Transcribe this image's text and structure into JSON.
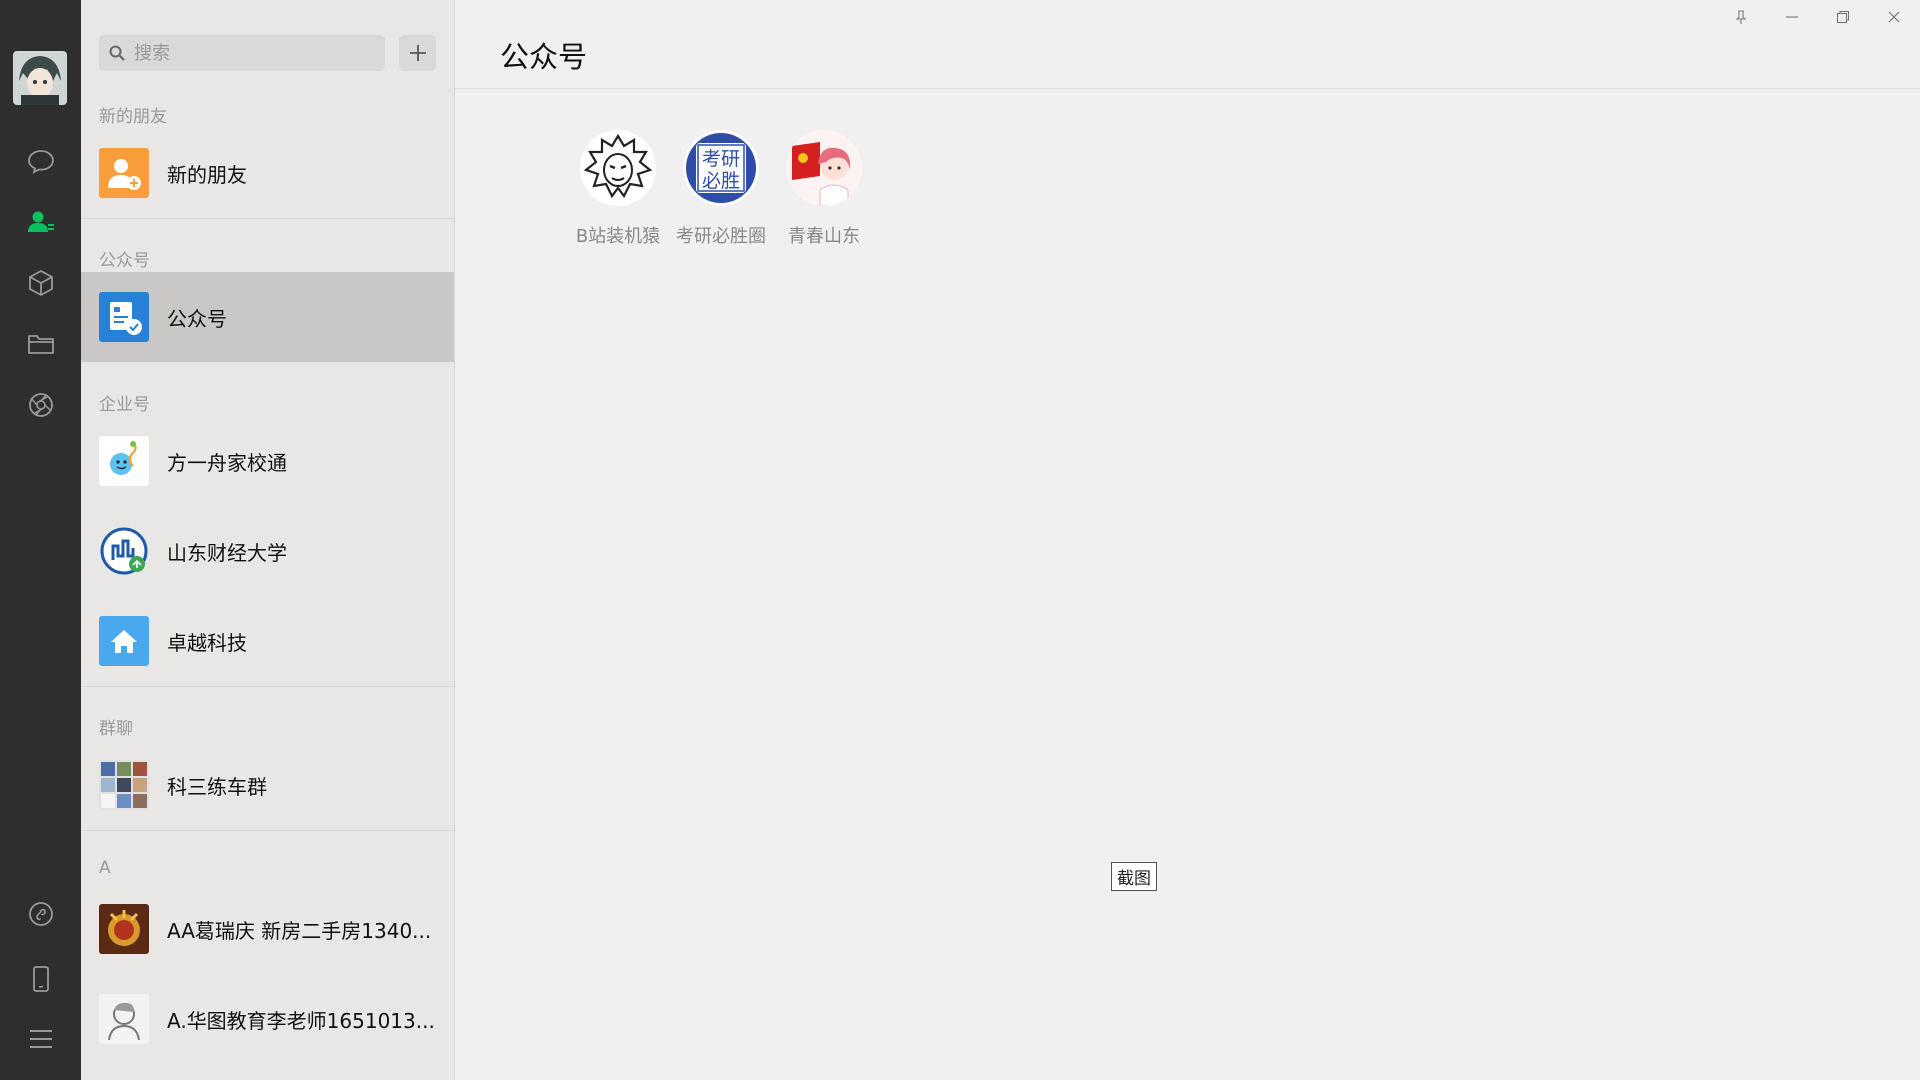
{
  "search": {
    "placeholder": "搜索"
  },
  "sections": {
    "new_friends": "新的朋友",
    "official": "公众号",
    "enterprise": "企业号",
    "groups": "群聊",
    "letter_a": "A"
  },
  "contacts": {
    "new_friends": "新的朋友",
    "official": "公众号",
    "enterprise_1": "方一舟家校通",
    "enterprise_2": "山东财经大学",
    "enterprise_3": "卓越科技",
    "group_1": "科三练车群",
    "a_1": "AA葛瑞庆 新房二手房1340...",
    "a_2": "A.华图教育李老师1651013..."
  },
  "main": {
    "title": "公众号",
    "accounts": [
      {
        "name": "B站装机猿"
      },
      {
        "name": "考研必胜圈",
        "badge_text": "考研必胜"
      },
      {
        "name": "青春山东"
      }
    ],
    "screenshot_tag": "截图"
  },
  "colors": {
    "nav_bg": "#2e2e2e",
    "accent": "#07c160",
    "list_bg": "#e8e7e6",
    "selected_bg": "#c9c8c7",
    "main_bg": "#f0f0f0"
  }
}
